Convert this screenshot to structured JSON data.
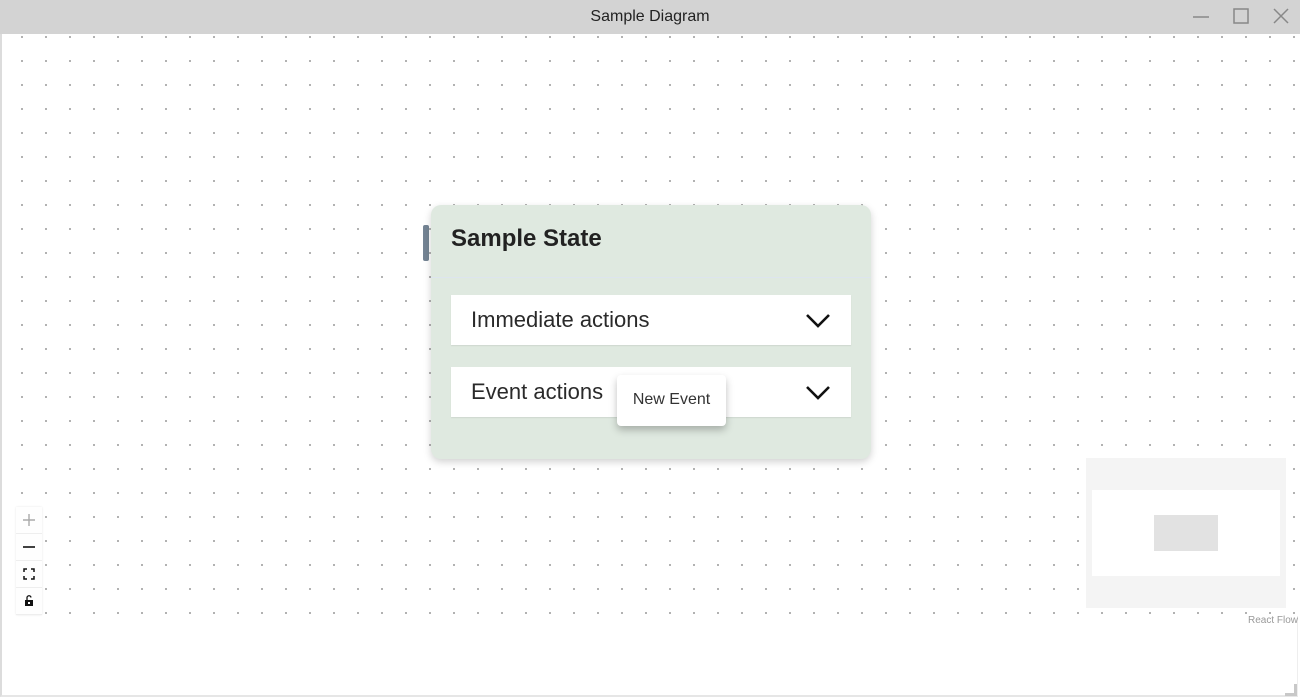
{
  "window": {
    "title": "Sample Diagram",
    "controls": [
      {
        "name": "minimize",
        "icon": "minimize-icon"
      },
      {
        "name": "maximize",
        "icon": "maximize-icon"
      },
      {
        "name": "close",
        "icon": "close-icon"
      }
    ]
  },
  "node": {
    "title": "Sample State",
    "sections": [
      {
        "label": "Immediate actions",
        "icon": "chevron-down-icon"
      },
      {
        "label": "Event actions",
        "icon": "chevron-down-icon"
      }
    ],
    "popup": {
      "label": "New Event"
    },
    "colors": {
      "background": "#dfe9e0",
      "handle": "#748494"
    }
  },
  "controls": [
    {
      "name": "zoom-in",
      "icon": "plus-icon"
    },
    {
      "name": "zoom-out",
      "icon": "minus-icon"
    },
    {
      "name": "fit-view",
      "icon": "fit-view-icon"
    },
    {
      "name": "toggle-interactivity",
      "icon": "unlock-icon"
    }
  ],
  "attribution": "React Flow"
}
